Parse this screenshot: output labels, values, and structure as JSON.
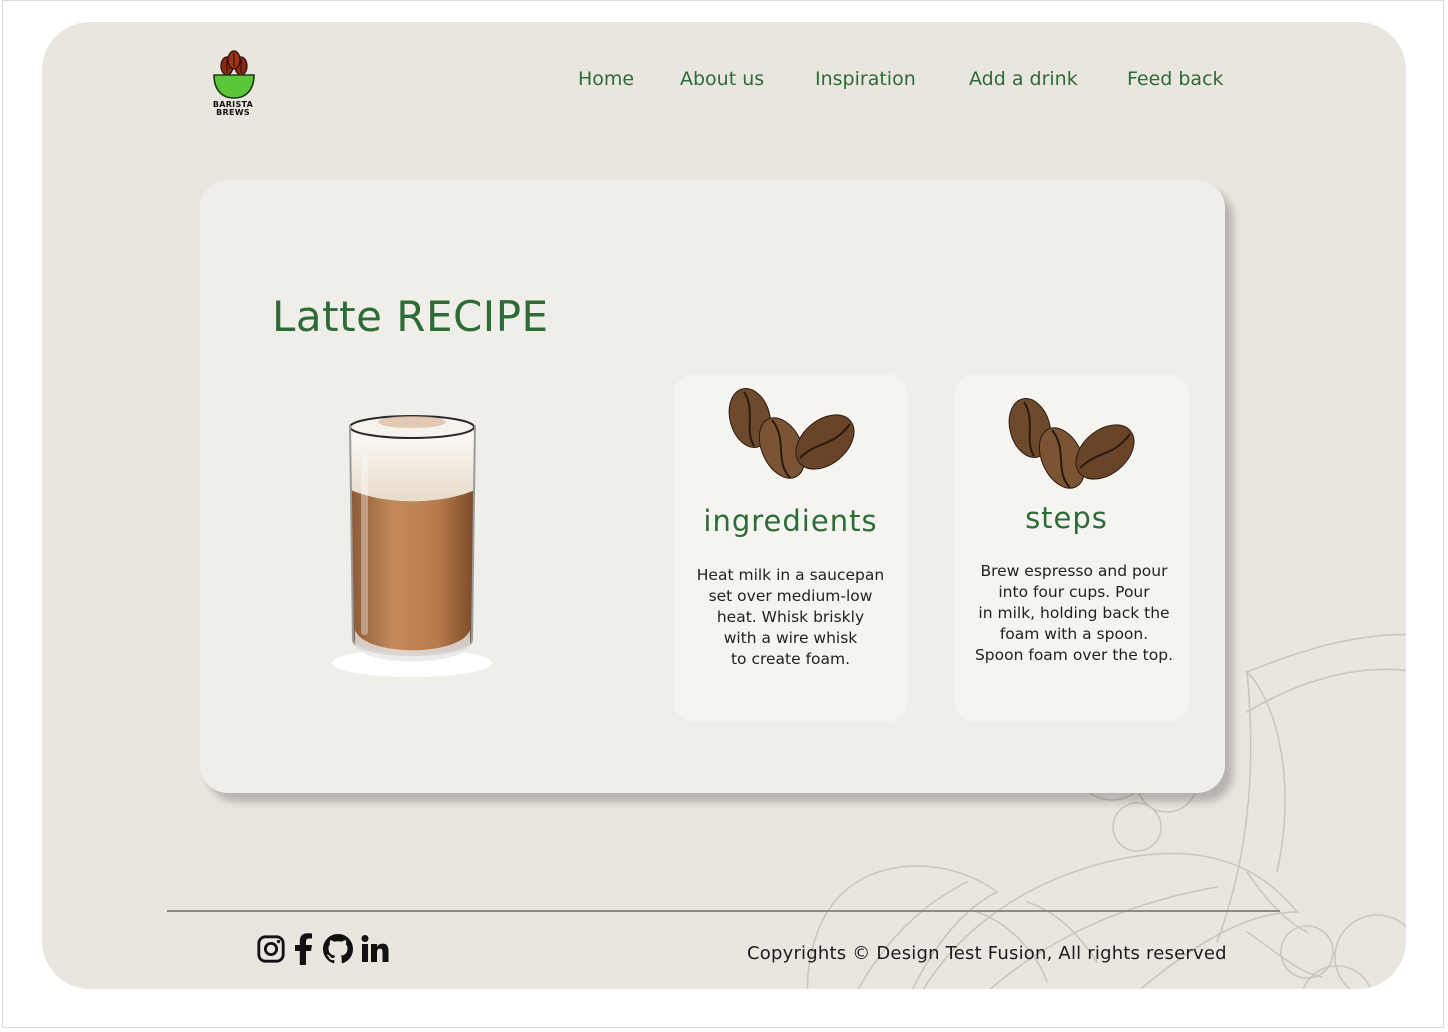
{
  "brand": {
    "logo_line1": "BARISTA",
    "logo_line2": "BREWS"
  },
  "nav": {
    "items": [
      {
        "label": "Home"
      },
      {
        "label": "About us"
      },
      {
        "label": "Inspiration"
      },
      {
        "label": "Add a drink"
      },
      {
        "label": "Feed back"
      }
    ]
  },
  "recipe": {
    "title": "Latte RECIPE"
  },
  "ingredients": {
    "heading": "ingredients",
    "text": "Heat milk in a saucepan\nset over medium-low\nheat. Whisk briskly\nwith a wire whisk\nto create foam."
  },
  "steps": {
    "heading": "steps",
    "text": "Brew espresso and pour\ninto four cups. Pour\nin milk, holding back the\nfoam with a spoon.\nSpoon foam over the top."
  },
  "footer": {
    "social": [
      "instagram-icon",
      "facebook-icon",
      "github-icon",
      "linkedin-icon"
    ],
    "copyright": "Copyrights © Design Test Fusion, All rights reserved"
  },
  "colors": {
    "accent_green": "#2e6b37",
    "page_bg": "#e9e6df",
    "card_bg": "#efeee9",
    "box_bg": "#f5f4f0"
  }
}
